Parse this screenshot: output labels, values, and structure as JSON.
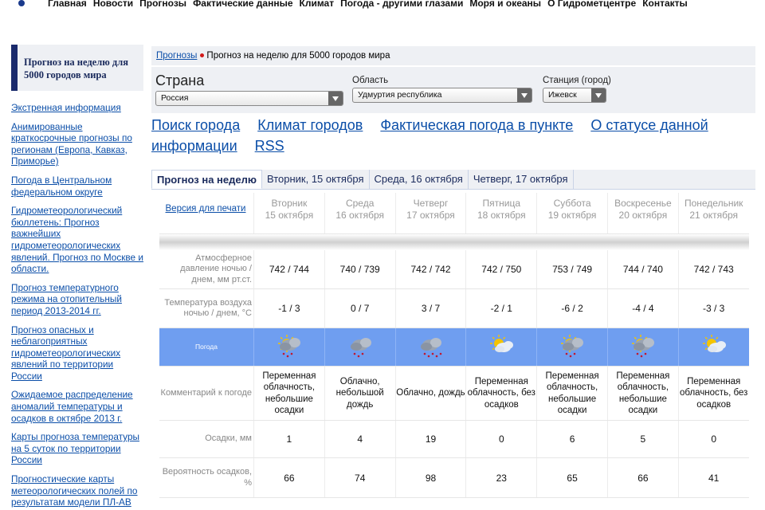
{
  "nav": {
    "items": [
      "Главная",
      "Новости",
      "Прогнозы",
      "Фактические данные",
      "Климат",
      "Погода - другими глазами",
      "Моря и океаны",
      "О Гидрометцентре",
      "Контакты"
    ]
  },
  "sidebar": {
    "title": "Прогноз на неделю для 5000 городов мира",
    "links": [
      "Экстренная информация",
      "Анимированные краткосрочные прогнозы по регионам (Европа, Кавказ, Приморье)",
      "Погода в Центральном федеральном округе",
      "Гидрометеорологический бюллетень: Прогноз важнейших гидрометеорологических явлений. Прогноз по Москве и области.",
      "Прогноз температурного режима на отопительный период 2013-2014 гг.",
      "Прогноз опасных и неблагоприятных гидрометеорологических явлений по территории России",
      "Ожидаемое распределение аномалий температуры и осадков в октябре 2013 г.",
      "Карты прогноза температуры на 5 суток по территории России",
      "Прогностические карты метеорологических полей по результатам модели ПЛ-АВ"
    ]
  },
  "breadcrumb": {
    "parent": "Прогнозы",
    "current": "Прогноз на неделю для 5000 городов мира"
  },
  "selectors": {
    "country": {
      "label": "Страна",
      "value": "Россия"
    },
    "region": {
      "label": "Область",
      "value": "Удмуртия республика"
    },
    "station": {
      "label": "Станция (город)",
      "value": "Ижевск"
    }
  },
  "links": [
    "Поиск города",
    "Климат городов",
    "Фактическая погода в пункте",
    "О статусе данной информации",
    "RSS"
  ],
  "tabs": [
    "Прогноз на неделю",
    "Вторник, 15 октября",
    "Среда, 16 октября",
    "Четверг, 17 октября"
  ],
  "forecast": {
    "print_link": "Версия для печати",
    "days": [
      {
        "day": "Вторник",
        "date": "15 октября",
        "pressure": "742 / 744",
        "temp": "-1 / 3",
        "icon": "partly-cloudy-light-rain-icon",
        "comment": "Переменная облачность, небольшие осадки",
        "precip": "1",
        "prob": "66"
      },
      {
        "day": "Среда",
        "date": "16 октября",
        "pressure": "740 / 739",
        "temp": "0 / 7",
        "icon": "cloudy-light-rain-icon",
        "comment": "Облачно, небольшой дождь",
        "precip": "4",
        "prob": "74"
      },
      {
        "day": "Четверг",
        "date": "17 октября",
        "pressure": "742 / 742",
        "temp": "3 / 7",
        "icon": "cloudy-rain-icon",
        "comment": "Облачно, дождь",
        "precip": "19",
        "prob": "98"
      },
      {
        "day": "Пятница",
        "date": "18 октября",
        "pressure": "742 / 750",
        "temp": "-2 / 1",
        "icon": "partly-cloudy-icon",
        "comment": "Переменная облачность, без осадков",
        "precip": "0",
        "prob": "23"
      },
      {
        "day": "Суббота",
        "date": "19 октября",
        "pressure": "753 / 749",
        "temp": "-6 / 2",
        "icon": "partly-cloudy-light-rain-icon",
        "comment": "Переменная облачность, небольшие осадки",
        "precip": "6",
        "prob": "65"
      },
      {
        "day": "Воскресенье",
        "date": "20 октября",
        "pressure": "744 / 740",
        "temp": "-4 / 4",
        "icon": "partly-cloudy-light-rain-icon",
        "comment": "Переменная облачность, небольшие осадки",
        "precip": "5",
        "prob": "66"
      },
      {
        "day": "Понедельник",
        "date": "21 октября",
        "pressure": "742 / 743",
        "temp": "-3 / 3",
        "icon": "partly-cloudy-icon",
        "comment": "Переменная облачность, без осадков",
        "precip": "0",
        "prob": "41"
      }
    ],
    "labels": {
      "pressure": "Атмосферное давление ночью / днем, мм рт.ст.",
      "temp": "Температура воздуха ночью / днем, °С",
      "weather": "Погода",
      "comment": "Комментарий к погоде",
      "precip": "Осадки, мм",
      "prob": "Вероятность осадков, %"
    }
  },
  "colors": {
    "link": "#0b4ea8",
    "weather_band": "#6f9ef0",
    "sidebar_accent": "#1a2a6c",
    "separator_dot": "#d21a1a"
  }
}
